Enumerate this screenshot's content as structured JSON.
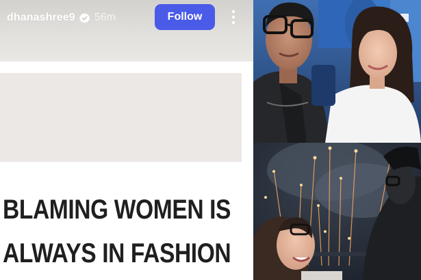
{
  "story": {
    "username": "dhanashree9",
    "timestamp": "56m",
    "follow_label": "Follow",
    "headline_line1": "BLAMING WOMEN IS",
    "headline_line2": "ALWAYS IN FASHION"
  },
  "icons": {
    "verified": "verified-badge-icon",
    "more": "more-options-icon"
  },
  "colors": {
    "follow_button": "#4a5be8",
    "headline_text": "#1f1f1f"
  }
}
